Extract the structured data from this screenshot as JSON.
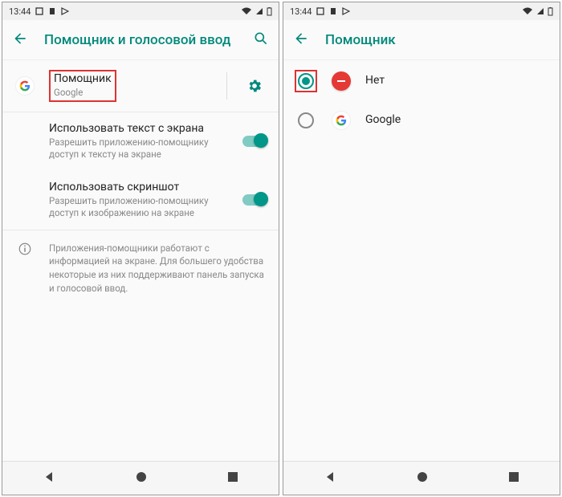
{
  "statusbar": {
    "time": "13:44"
  },
  "left": {
    "title": "Помощник и голосовой ввод",
    "assistant": {
      "title": "Помощник",
      "sub": "Google"
    },
    "useText": {
      "title": "Использовать текст с экрана",
      "sub": "Разрешить приложению-помощнику доступ к тексту на экране"
    },
    "useScreenshot": {
      "title": "Использовать скриншот",
      "sub": "Разрешить приложению-помощнику доступ к изображению на экране"
    },
    "infoText": "Приложения-помощники работают с информацией на экране. Для большего удобства некоторые из них поддерживают панель запуска и голосовой ввод."
  },
  "right": {
    "title": "Помощник",
    "optionNone": "Нет",
    "optionGoogle": "Google"
  }
}
